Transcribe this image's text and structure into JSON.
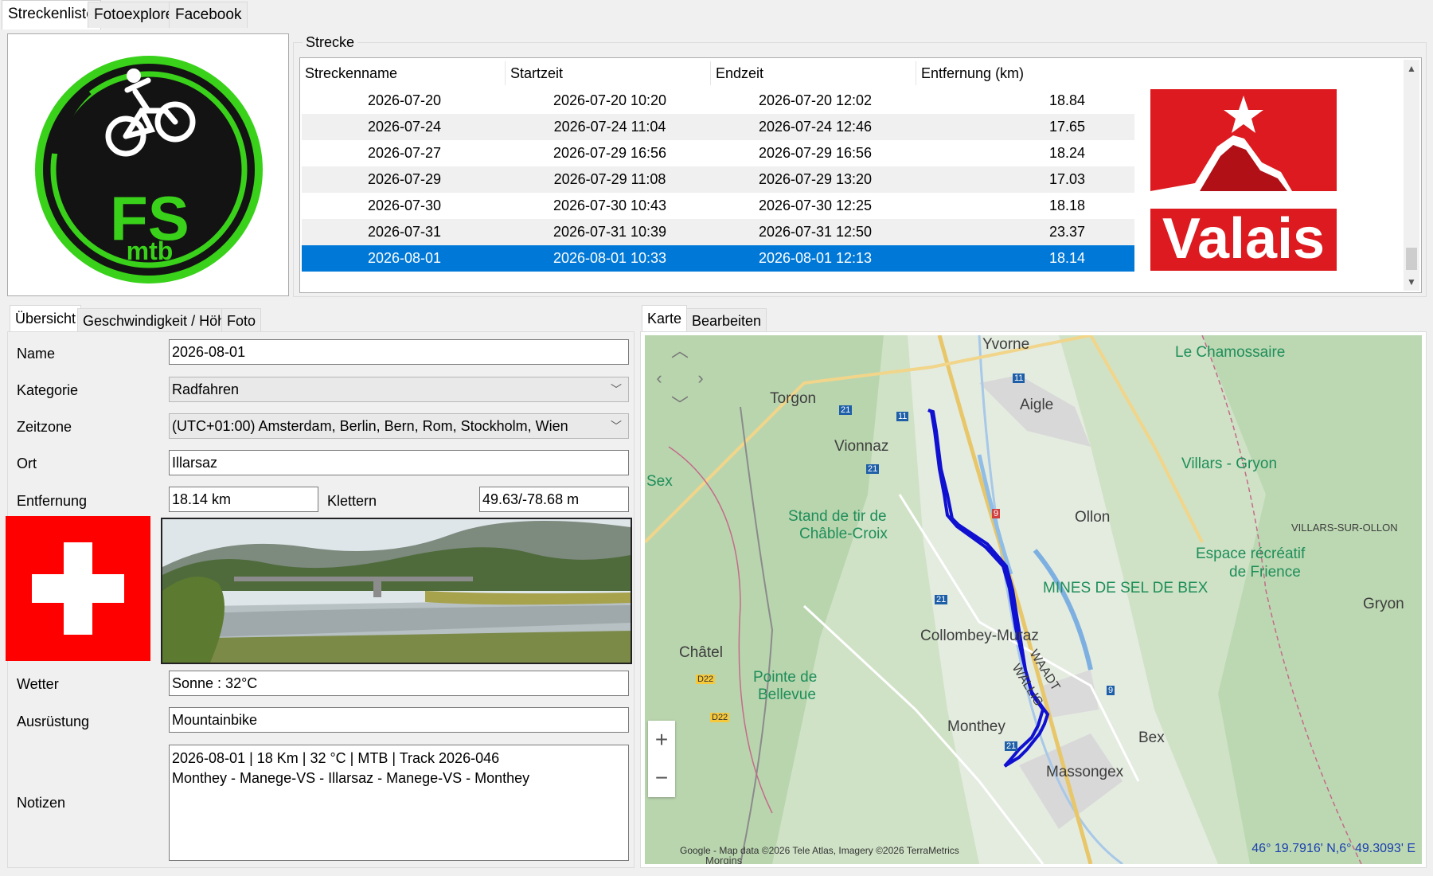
{
  "tabs": [
    "Streckenliste",
    "Fotoexplorer",
    "Facebook"
  ],
  "logo": {
    "text_top": "FS",
    "text_bottom": "mtb"
  },
  "strecke": {
    "group_title": "Strecke",
    "columns": [
      "Streckenname",
      "Startzeit",
      "Endzeit",
      "Entfernung (km)"
    ],
    "rows": [
      [
        "2026-07-20",
        "2026-07-20 10:20",
        "2026-07-20 12:02",
        "18.84"
      ],
      [
        "2026-07-24",
        "2026-07-24 11:04",
        "2026-07-24 12:46",
        "17.65"
      ],
      [
        "2026-07-27",
        "2026-07-29 16:56",
        "2026-07-29 16:56",
        "18.24"
      ],
      [
        "2026-07-29",
        "2026-07-29 11:08",
        "2026-07-29 13:20",
        "17.03"
      ],
      [
        "2026-07-30",
        "2026-07-30 10:43",
        "2026-07-30 12:25",
        "18.18"
      ],
      [
        "2026-07-31",
        "2026-07-31 10:39",
        "2026-07-31 12:50",
        "23.37"
      ],
      [
        "2026-08-01",
        "2026-08-01 10:33",
        "2026-08-01 12:13",
        "18.14"
      ]
    ],
    "selected_index": 6,
    "valais_logo_text": "Valais"
  },
  "left_tabs": [
    "Übersicht",
    "Geschwindigkeit / Höhe",
    "Foto"
  ],
  "form": {
    "name_label": "Name",
    "name_value": "2026-08-01",
    "kategorie_label": "Kategorie",
    "kategorie_value": "Radfahren",
    "zeitzone_label": "Zeitzone",
    "zeitzone_value": "(UTC+01:00) Amsterdam, Berlin, Bern, Rom, Stockholm, Wien",
    "ort_label": "Ort",
    "ort_value": "Illarsaz",
    "entfernung_label": "Entfernung",
    "entfernung_value": "18.14 km",
    "klettern_label": "Klettern",
    "klettern_value": "49.63/-78.68 m",
    "wetter_label": "Wetter",
    "wetter_value": "Sonne  :  32°C",
    "ausruestung_label": "Ausrüstung",
    "ausruestung_value": "Mountainbike",
    "notizen_label": "Notizen",
    "notizen_line1": "2026-08-01  |  18 Km  |  32 °C  |  MTB  |  Track 2026-046",
    "notizen_line2": "Monthey - Manege-VS - Illarsaz - Manege-VS - Monthey"
  },
  "right_tabs": [
    "Karte",
    "Bearbeiten"
  ],
  "map": {
    "places": [
      "Yvorne",
      "Le Chamossaire",
      "Torgon",
      "Aigle",
      "Vionnaz",
      "Villars - Gryon",
      "VILLARS-SUR-OLLON",
      "Sex",
      "Stand de tir de",
      "Châble-Croix",
      "Ollon",
      "Espace récréatif",
      "de Frience",
      "MINES DE SEL DE BEX",
      "Gryon",
      "Collombey-Muraz",
      "Châtel",
      "WAADT",
      "WALLIS",
      "Pointe de",
      "Bellevue",
      "Monthey",
      "Bex",
      "Massongex",
      "Morgins"
    ],
    "roads": [
      "11",
      "21",
      "11",
      "21",
      "9",
      "21",
      "9",
      "21",
      "D22",
      "D22"
    ],
    "attribution": "Google - Map data ©2026 Tele Atlas, Imagery ©2026 TerraMetrics",
    "coords": "46° 19.7916' N,6° 49.3093' E",
    "zoom_in": "+",
    "zoom_out": "−"
  },
  "colors": {
    "selection": "#0078d7",
    "track": "#1010d0",
    "valais_red": "#dc1a1f",
    "swiss_red": "#ff0000",
    "logo_green": "#39d11a"
  }
}
